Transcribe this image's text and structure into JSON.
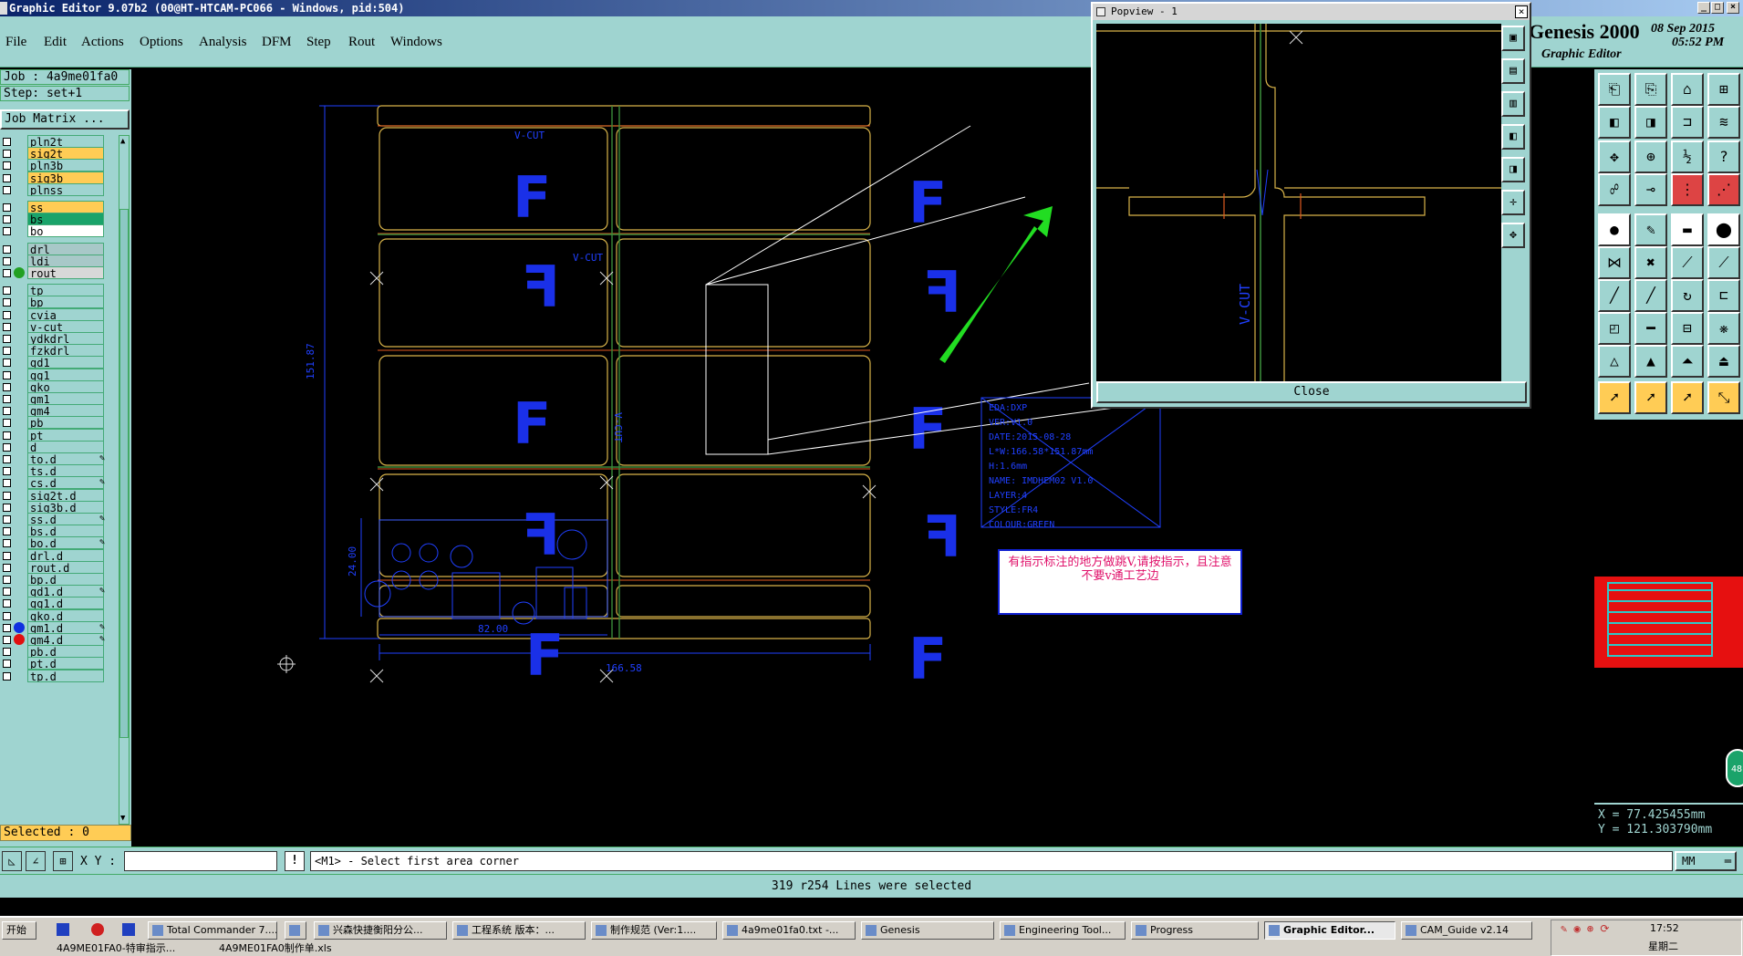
{
  "window": {
    "title": "Graphic Editor 9.07b2 (00@HT-HTCAM-PC066 - Windows, pid:504)",
    "controls": [
      "_",
      "□",
      "×"
    ]
  },
  "menu": [
    "File",
    "Edit",
    "Actions",
    "Options",
    "Analysis",
    "DFM",
    "Step",
    "Rout",
    "Windows"
  ],
  "brand": {
    "name": "Genesis 2000",
    "subtitle": "Graphic Editor",
    "date": "08 Sep 2015",
    "time": "05:52 PM"
  },
  "job": {
    "job_label": "Job : 4a9me01fa0",
    "step_label": "Step: set+1",
    "matrix_button": "Job Matrix ..."
  },
  "layers": [
    {
      "name": "pln2t",
      "color": "#9fd4d0"
    },
    {
      "name": "sig2t",
      "color": "#ffcc55"
    },
    {
      "name": "pln3b",
      "color": "#9fd4d0"
    },
    {
      "name": "sig3b",
      "color": "#ffcc55"
    },
    {
      "name": "plnss",
      "color": "#9fd4d0"
    },
    {
      "name": "ss",
      "color": "#ffcc55"
    },
    {
      "name": "bs",
      "color": "#1aa36a"
    },
    {
      "name": "bo",
      "color": "#ffffff"
    },
    {
      "name": "drl",
      "color": "#a8c8c8"
    },
    {
      "name": "ldi",
      "color": "#a8c8c8"
    },
    {
      "name": "rout",
      "color": "#d8d8d8",
      "dot": "#22a022"
    },
    {
      "name": "tp",
      "color": "#9fd4d0"
    },
    {
      "name": "bp",
      "color": "#9fd4d0"
    },
    {
      "name": "cvia",
      "color": "#9fd4d0"
    },
    {
      "name": "v-cut",
      "color": "#9fd4d0"
    },
    {
      "name": "ydkdrl",
      "color": "#9fd4d0"
    },
    {
      "name": "fzkdrl",
      "color": "#9fd4d0"
    },
    {
      "name": "gd1",
      "color": "#9fd4d0"
    },
    {
      "name": "gg1",
      "color": "#9fd4d0"
    },
    {
      "name": "gko",
      "color": "#9fd4d0"
    },
    {
      "name": "gm1",
      "color": "#9fd4d0"
    },
    {
      "name": "gm4",
      "color": "#9fd4d0"
    },
    {
      "name": "pb",
      "color": "#9fd4d0"
    },
    {
      "name": "pt",
      "color": "#9fd4d0"
    },
    {
      "name": "d",
      "color": "#9fd4d0"
    },
    {
      "name": "to.d",
      "color": "#9fd4d0",
      "edit": true
    },
    {
      "name": "ts.d",
      "color": "#9fd4d0"
    },
    {
      "name": "cs.d",
      "color": "#9fd4d0",
      "edit": true
    },
    {
      "name": "sig2t.d",
      "color": "#9fd4d0"
    },
    {
      "name": "sig3b.d",
      "color": "#9fd4d0"
    },
    {
      "name": "ss.d",
      "color": "#9fd4d0",
      "edit": true
    },
    {
      "name": "bs.d",
      "color": "#9fd4d0"
    },
    {
      "name": "bo.d",
      "color": "#9fd4d0",
      "edit": true
    },
    {
      "name": "drl.d",
      "color": "#9fd4d0"
    },
    {
      "name": "rout.d",
      "color": "#9fd4d0"
    },
    {
      "name": "bp.d",
      "color": "#9fd4d0"
    },
    {
      "name": "gd1.d",
      "color": "#9fd4d0",
      "edit": true
    },
    {
      "name": "gg1.d",
      "color": "#9fd4d0"
    },
    {
      "name": "gko.d",
      "color": "#9fd4d0"
    },
    {
      "name": "gm1.d",
      "color": "#9fd4d0",
      "dot": "#1030e0",
      "edit": true
    },
    {
      "name": "gm4.d",
      "color": "#9fd4d0",
      "dot": "#e01010",
      "edit": true
    },
    {
      "name": "pb.d",
      "color": "#9fd4d0"
    },
    {
      "name": "pt.d",
      "color": "#9fd4d0"
    },
    {
      "name": "tp.d",
      "color": "#9fd4d0"
    }
  ],
  "selected_label": "Selected : 0",
  "popview": {
    "title": "Popview - 1",
    "close_label": "Close",
    "vcut_text": "V-CUT"
  },
  "board": {
    "vcut_label_1": "V-CUT",
    "vcut_label_2": "V-CUT",
    "vcut_label_3": "V-CUT",
    "dim_height": "151.87",
    "dim_width": "166.58",
    "dim_small_w": "82.00",
    "dim_small_h": "24.00",
    "panel_letter": "F"
  },
  "info_box": {
    "lines": [
      "EDA:DXP",
      "VER:V1.0",
      "DATE:2015-08-28",
      "L*W:166.58*151.87mm",
      "H:1.6mm",
      "NAME: IMDHEM02 V1.0",
      "LAYER:4",
      "STYLE:FR4",
      "COLOUR:GREEN"
    ]
  },
  "annotation": {
    "text": "有指示标注的地方做跳V,请按指示，且注意不要v通工艺边"
  },
  "coords": {
    "x": "X = 77.425455mm",
    "y": "Y = 121.303790mm"
  },
  "badge_number": "48",
  "command": {
    "xy_label": "X Y :",
    "xy_value": "",
    "prompt": "<M1> - Select first area corner",
    "units": "MM"
  },
  "status_message": "319 r254 Lines were selected",
  "taskbar": {
    "start": "开始",
    "tasks": [
      {
        "label": "Total Commander 7...."
      },
      {
        "label": ""
      },
      {
        "label": "兴森快捷衡阳分公..."
      },
      {
        "label": "工程系统   版本：..."
      },
      {
        "label": "制作规范 (Ver:1...."
      },
      {
        "label": "4a9me01fa0.txt -..."
      },
      {
        "label": "Genesis"
      },
      {
        "label": "Engineering Tool..."
      },
      {
        "label": "Progress"
      },
      {
        "label": "Graphic Editor...",
        "active": true
      },
      {
        "label": "CAM_Guide v2.14"
      }
    ],
    "tasks_row2": [
      "4A9ME01FA0-特审指示...",
      "4A9ME01FA0制作单.xls"
    ],
    "clock": "17:52",
    "day": "星期二"
  },
  "colors": {
    "panel": "#9fd4d0",
    "profile": "#d9b44a",
    "dim": "#2040ff",
    "arrow": "#22dd22",
    "note_text": "#e0106a"
  }
}
